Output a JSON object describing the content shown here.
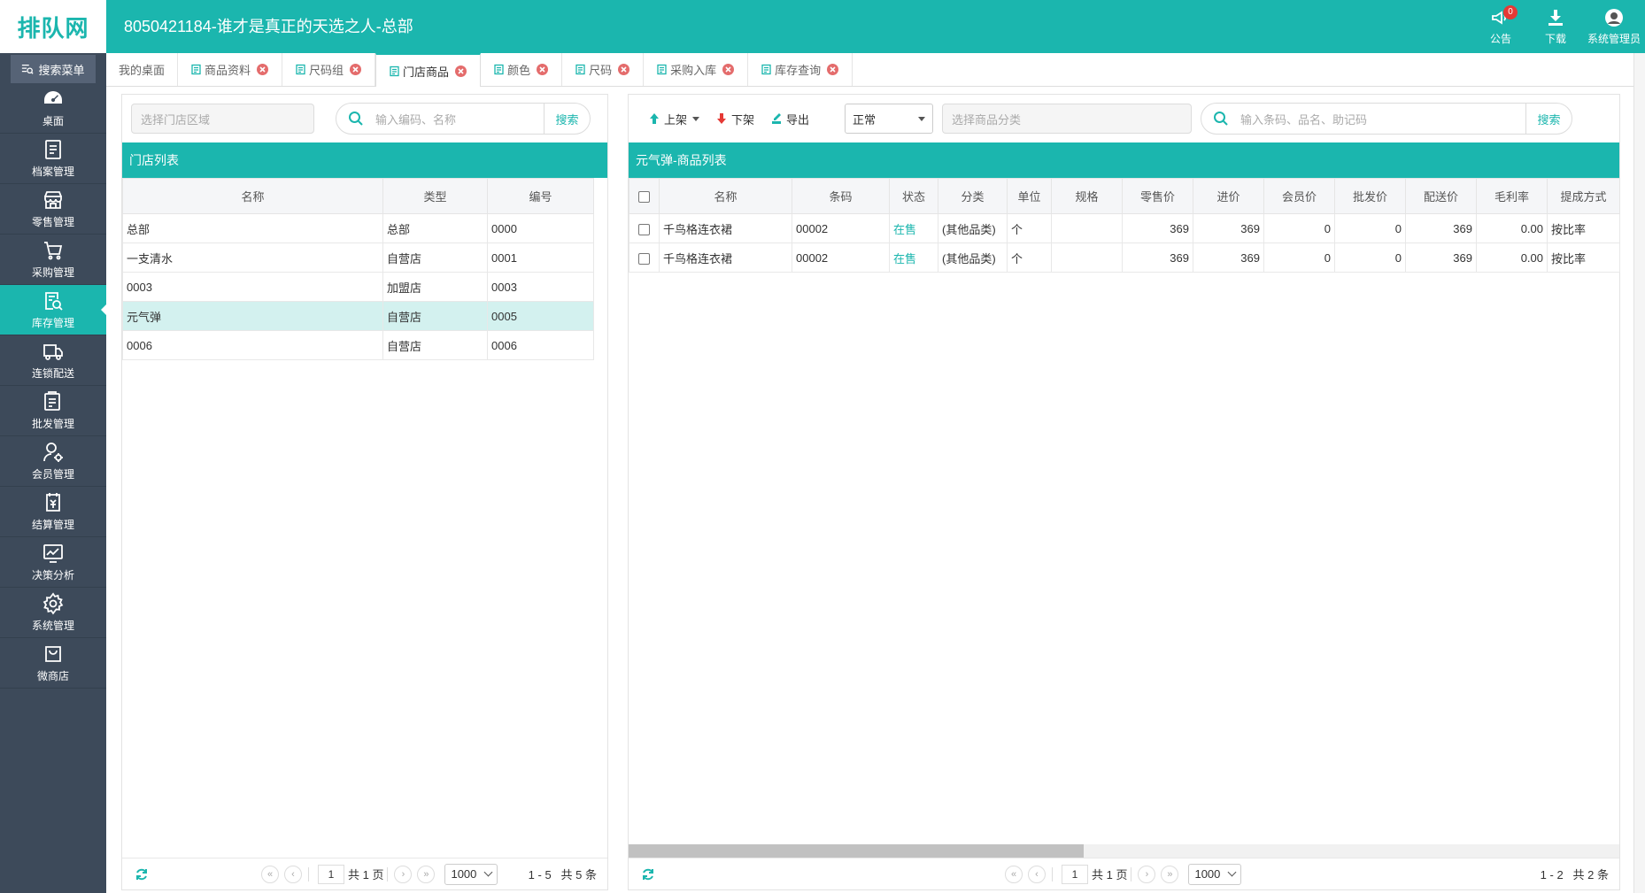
{
  "app": {
    "logo": "排队网",
    "title": "8050421184-谁才是真正的天选之人-总部"
  },
  "top_actions": {
    "notice_label": "公告",
    "notice_count": "0",
    "download_label": "下载",
    "user_label": "系统管理员"
  },
  "sidebar": {
    "search_label": "搜索菜单",
    "items": [
      {
        "label": "桌面",
        "icon": "dashboard-icon"
      },
      {
        "label": "档案管理",
        "icon": "archive-icon"
      },
      {
        "label": "零售管理",
        "icon": "store-icon"
      },
      {
        "label": "采购管理",
        "icon": "cart-icon"
      },
      {
        "label": "库存管理",
        "icon": "inventory-search-icon",
        "active": true
      },
      {
        "label": "连锁配送",
        "icon": "truck-icon"
      },
      {
        "label": "批发管理",
        "icon": "wholesale-icon"
      },
      {
        "label": "会员管理",
        "icon": "member-icon"
      },
      {
        "label": "结算管理",
        "icon": "settlement-icon"
      },
      {
        "label": "决策分析",
        "icon": "analysis-icon"
      },
      {
        "label": "系统管理",
        "icon": "gear-icon"
      },
      {
        "label": "微商店",
        "icon": "bag-icon"
      }
    ]
  },
  "tabs": [
    {
      "label": "我的桌面",
      "closable": false
    },
    {
      "label": "商品资料",
      "closable": true
    },
    {
      "label": "尺码组",
      "closable": true
    },
    {
      "label": "门店商品",
      "closable": true,
      "active": true
    },
    {
      "label": "颜色",
      "closable": true
    },
    {
      "label": "尺码",
      "closable": true
    },
    {
      "label": "采购入库",
      "closable": true
    },
    {
      "label": "库存查询",
      "closable": true
    }
  ],
  "left_panel": {
    "region_placeholder": "选择门店区域",
    "search_placeholder": "输入编码、名称",
    "search_button": "搜索",
    "header": "门店列表",
    "columns": [
      "名称",
      "类型",
      "编号"
    ],
    "rows": [
      {
        "name": "总部",
        "type": "总部",
        "code": "0000"
      },
      {
        "name": "一支清水",
        "type": "自营店",
        "code": "0001"
      },
      {
        "name": "0003",
        "type": "加盟店",
        "code": "0003"
      },
      {
        "name": "元气弹",
        "type": "自营店",
        "code": "0005",
        "selected": true
      },
      {
        "name": "0006",
        "type": "自营店",
        "code": "0006"
      }
    ],
    "pager": {
      "page": "1",
      "total_pages": "共 1 页",
      "page_size": "1000",
      "range": "1 - 5",
      "total": "共 5 条"
    }
  },
  "right_panel": {
    "btn_up": "上架",
    "btn_down": "下架",
    "btn_export": "导出",
    "status_select": "正常",
    "category_placeholder": "选择商品分类",
    "search_placeholder": "输入条码、品名、助记码",
    "search_button": "搜索",
    "header": "元气弹-商品列表",
    "columns": [
      "名称",
      "条码",
      "状态",
      "分类",
      "单位",
      "规格",
      "零售价",
      "进价",
      "会员价",
      "批发价",
      "配送价",
      "毛利率",
      "提成方式"
    ],
    "rows": [
      {
        "name": "千鸟格连衣裙",
        "barcode": "00002",
        "status": "在售",
        "category": "(其他品类)",
        "unit": "个",
        "spec": "",
        "retail": "369",
        "purchase": "369",
        "member": "0",
        "wholesale": "0",
        "delivery": "369",
        "margin": "0.00",
        "commission": "按比率"
      },
      {
        "name": "千鸟格连衣裙",
        "barcode": "00002",
        "status": "在售",
        "category": "(其他品类)",
        "unit": "个",
        "spec": "",
        "retail": "369",
        "purchase": "369",
        "member": "0",
        "wholesale": "0",
        "delivery": "369",
        "margin": "0.00",
        "commission": "按比率"
      }
    ],
    "pager": {
      "page": "1",
      "total_pages": "共 1 页",
      "page_size": "1000",
      "range": "1 - 2",
      "total": "共 2 条"
    }
  },
  "colors": {
    "accent": "#1bb6ae",
    "sidebar": "#3d4a5a",
    "danger": "#e53935",
    "selected_row": "#d3f1ef"
  }
}
